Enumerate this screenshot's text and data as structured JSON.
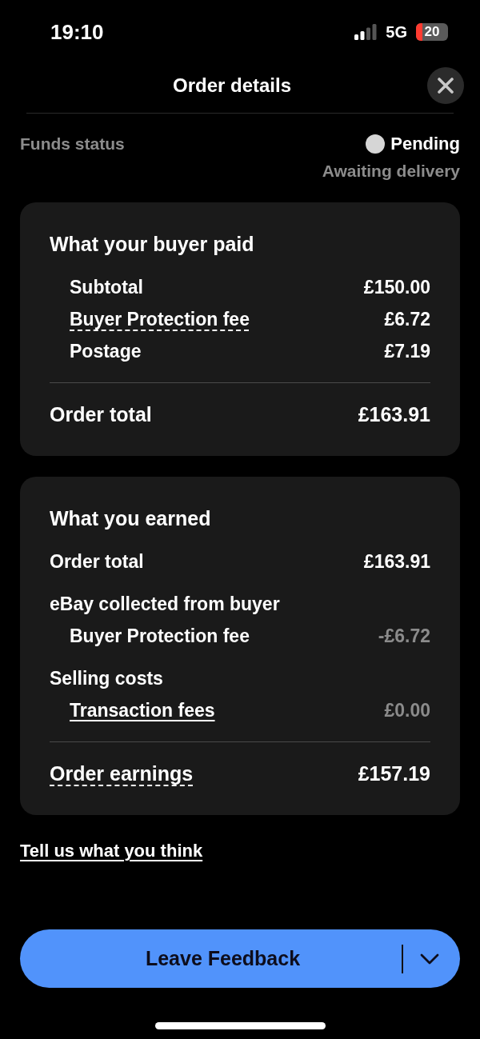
{
  "status_bar": {
    "time": "19:10",
    "network": "5G",
    "battery": "20"
  },
  "header": {
    "title": "Order details"
  },
  "funds_status": {
    "label": "Funds status",
    "status": "Pending",
    "note": "Awaiting delivery"
  },
  "cards": [
    {
      "heading": {
        "label": "What your buyer paid",
        "children": [
          {
            "label": "Subtotal",
            "value": "£150.00",
            "kind": "text",
            "muted": false
          },
          {
            "label": "Buyer Protection fee",
            "value": "£6.72",
            "kind": "term",
            "muted": false
          },
          {
            "label": "Postage",
            "value": "£7.19",
            "kind": "text",
            "muted": false
          }
        ]
      },
      "total": {
        "label": "Order total",
        "value": "£163.91",
        "kind": "text"
      }
    },
    {
      "heading": {
        "label": "What you earned"
      },
      "rows": [
        {
          "label": "Order total",
          "value": "£163.91",
          "kind": "text",
          "muted": false
        },
        {
          "label": "eBay collected from buyer",
          "kind": "text",
          "children": [
            {
              "label": "Buyer Protection fee",
              "value": "-£6.72",
              "kind": "text",
              "muted": true
            }
          ]
        },
        {
          "label": "Selling costs",
          "kind": "text",
          "children": [
            {
              "label": "Transaction fees",
              "value": "£0.00",
              "kind": "link",
              "muted": true
            }
          ]
        }
      ],
      "total": {
        "label": "Order earnings",
        "value": "£157.19",
        "kind": "term"
      }
    }
  ],
  "feedback_link": {
    "label": "Tell us what you think"
  },
  "button": {
    "label": "Leave Feedback"
  }
}
